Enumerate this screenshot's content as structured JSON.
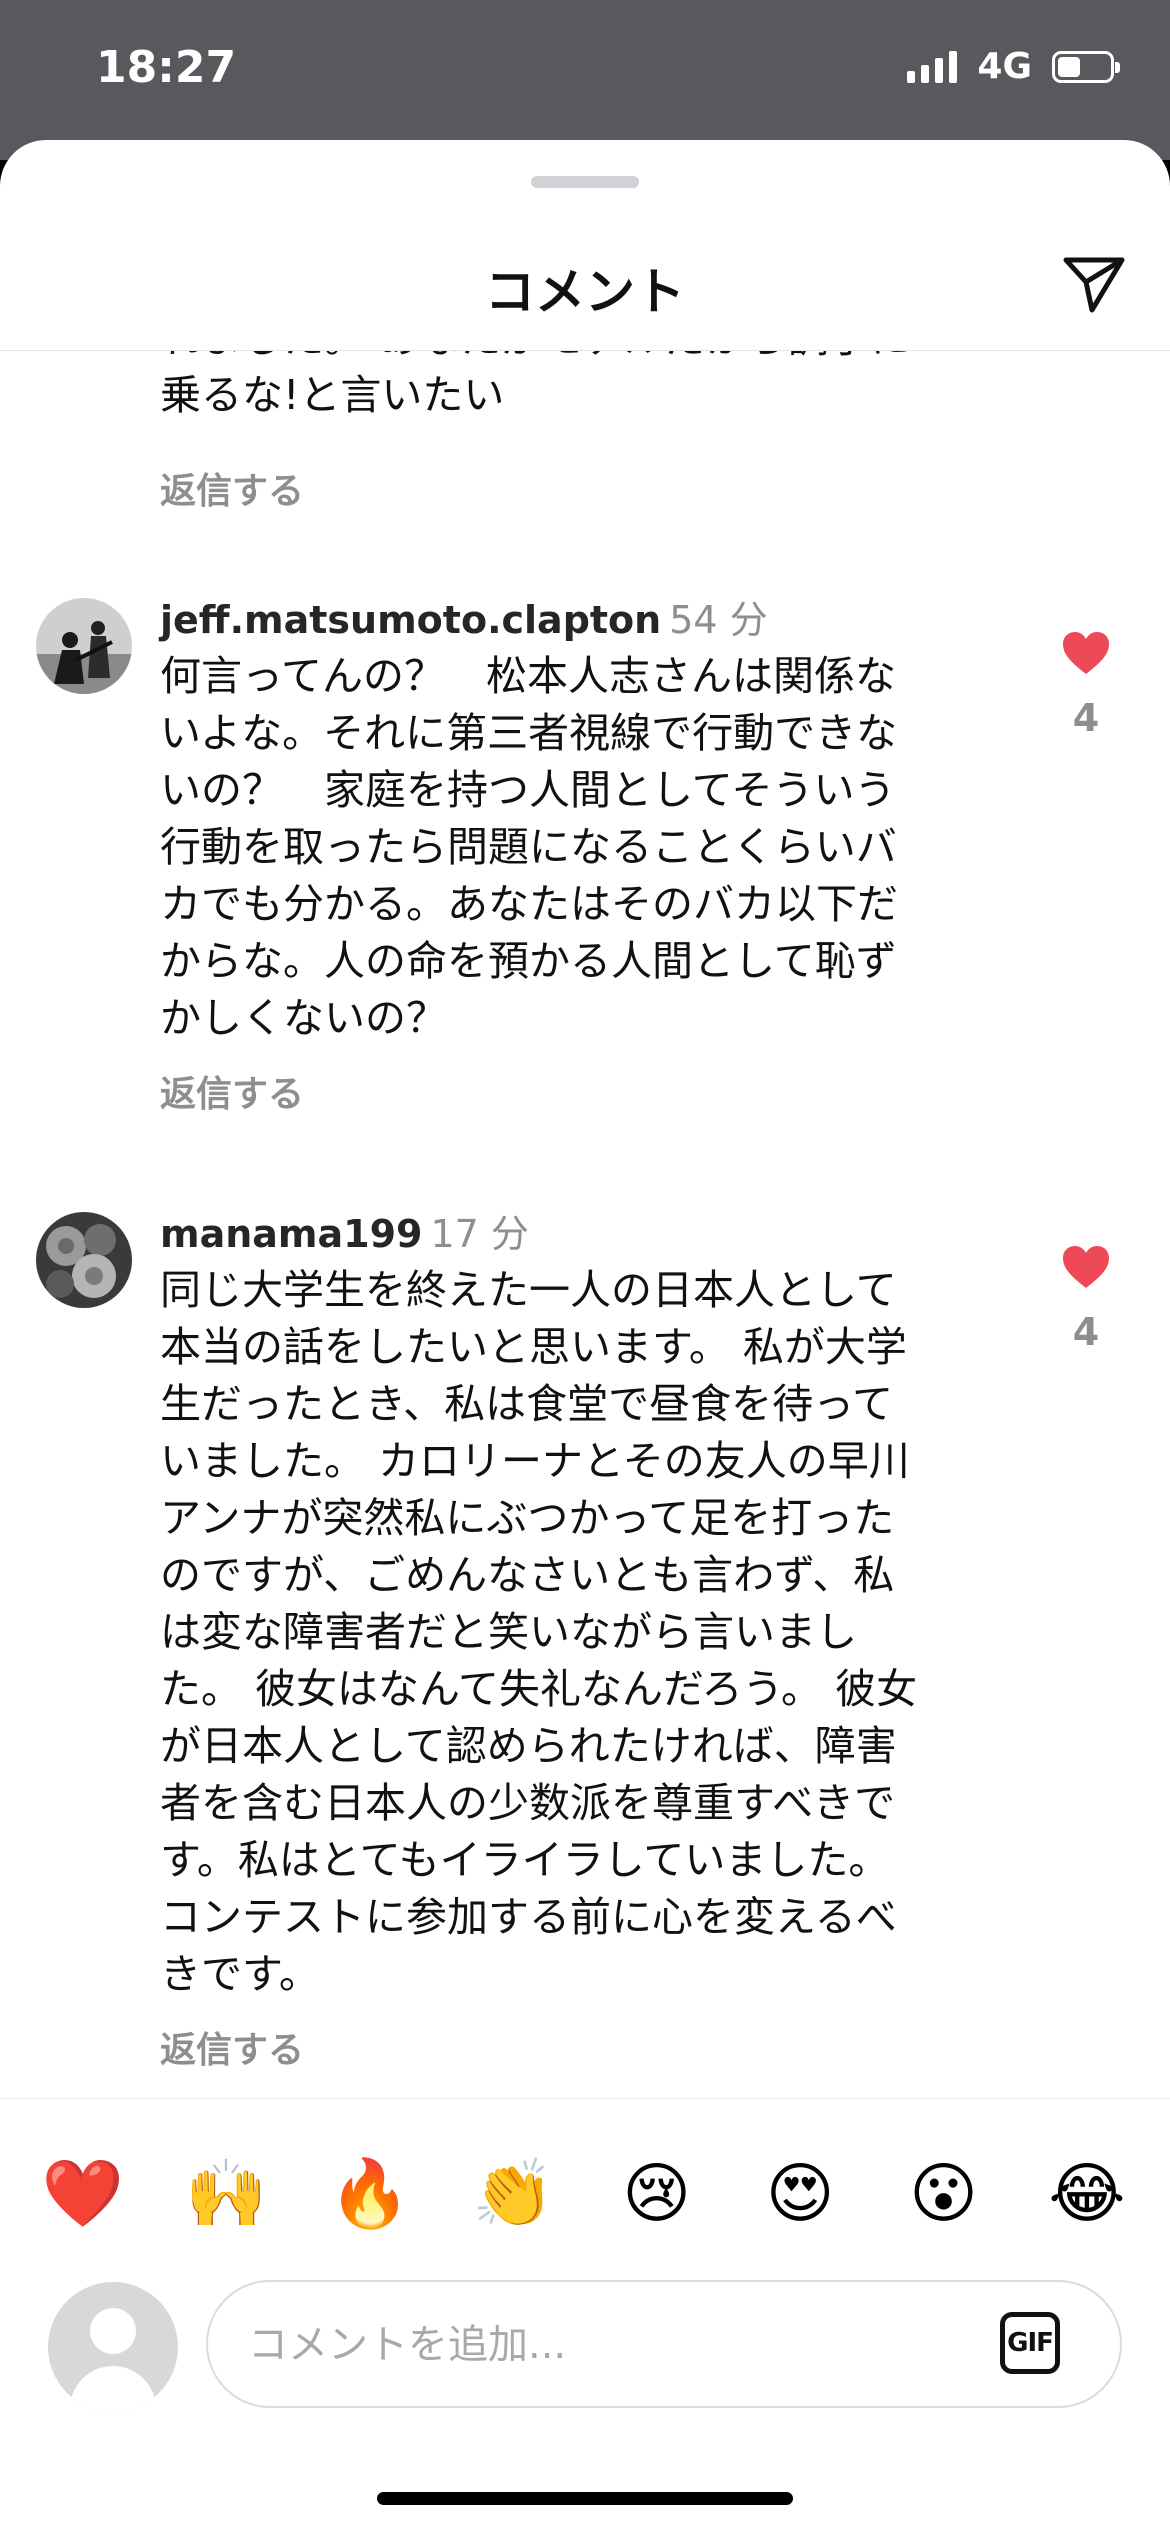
{
  "status": {
    "time": "18:27",
    "network": "4G"
  },
  "header": {
    "title": "コメント"
  },
  "previous_comment": {
    "text": "れました。 あなたがモデルだから調子に\n乗るな!と言いたい",
    "reply_label": "返信する"
  },
  "comments": [
    {
      "username": "jeff.matsumoto.clapton",
      "time": "54 分",
      "text": "何言ってんの？　松本人志さんは関係な\nいよな。それに第三者視線で行動できな\nいの？　家庭を持つ人間としてそういう\n行動を取ったら問題になることくらいバ\nカでも分かる。あなたはそのバカ以下だ\nからな。人の命を預かる人間として恥ず\nかしくないの？",
      "likes": "4",
      "liked": true,
      "reply_label": "返信する"
    },
    {
      "username": "manama199",
      "time": "17 分",
      "text": "同じ大学生を終えた一人の日本人として\n本当の話をしたいと思います。 私が大学\n生だったとき、私は食堂で昼食を待って\nいました。 カロリーナとその友人の早川\nアンナが突然私にぶつかって足を打った\nのですが、ごめんなさいとも言わず、私\nは変な障害者だと笑いながら言いまし\nた。 彼女はなんて失礼なんだろう。 彼女\nが日本人として認められたければ、障害\n者を含む日本人の少数派を尊重すべきで\nす。私はとてもイライラしていました。\nコンテストに参加する前に心を変えるべ\nきです。",
      "likes": "4",
      "liked": true,
      "reply_label": "返信する"
    }
  ],
  "emoji_bar": [
    "❤️",
    "🙌",
    "🔥",
    "👏",
    "😢",
    "😍",
    "😮",
    "😂"
  ],
  "composer": {
    "placeholder": "コメントを追加...",
    "gif_label": "GIF"
  },
  "colors": {
    "like_red": "#ed4956",
    "status_bar": "#58595d"
  }
}
